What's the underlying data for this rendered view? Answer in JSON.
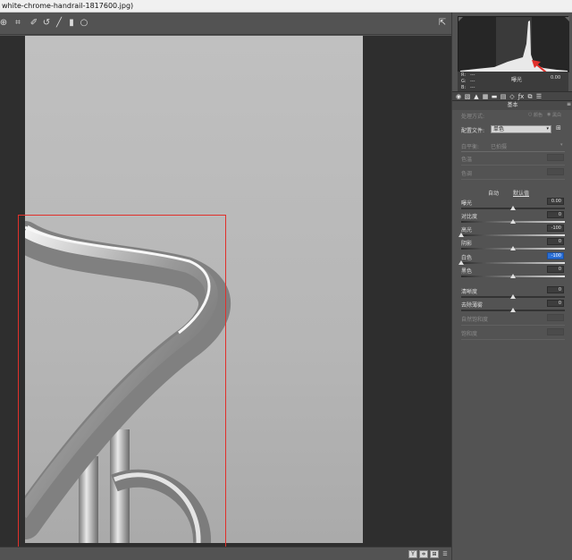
{
  "window": {
    "title": "white-chrome-handrail-1817600.jpg)"
  },
  "histogram": {
    "rgb_labels": [
      "R:",
      "G:",
      "B:"
    ],
    "rgb_values": [
      "---",
      "---",
      "---"
    ],
    "readout_label": "曝光",
    "readout_value": "0.00"
  },
  "panel": {
    "section_title": "基本",
    "process_label": "处理方式:",
    "process_options": [
      "颜色",
      "黑白"
    ],
    "profile_label": "配置文件:",
    "profile_value": "单色",
    "wb_label": "白平衡:",
    "wb_value": "已拍摄",
    "temp_label": "色温",
    "tint_label": "色调",
    "auto_label": "自动",
    "default_label": "默认值",
    "sliders": [
      {
        "label": "曝光",
        "value": "0.00",
        "level": 0.5
      },
      {
        "label": "对比度",
        "value": "0",
        "level": 0.5
      },
      {
        "label": "高光",
        "value": "-100",
        "level": 0.0
      },
      {
        "label": "阴影",
        "value": "0",
        "level": 0.5
      },
      {
        "label": "白色",
        "value": "-100",
        "level": 0.0
      },
      {
        "label": "黑色",
        "value": "0",
        "level": 0.5
      },
      {
        "label": "清晰度",
        "value": "0",
        "level": 0.5
      },
      {
        "label": "去除薄雾",
        "value": "0",
        "level": 0.5
      }
    ],
    "vibrance_label": "自然饱和度",
    "saturation_label": "饱和度"
  },
  "bottom": {
    "buttons": [
      "Y",
      "≑",
      "⊞",
      "☰"
    ]
  },
  "colors": {
    "accent_red": "#e0302b",
    "selected_field": "#2a6fd6"
  }
}
